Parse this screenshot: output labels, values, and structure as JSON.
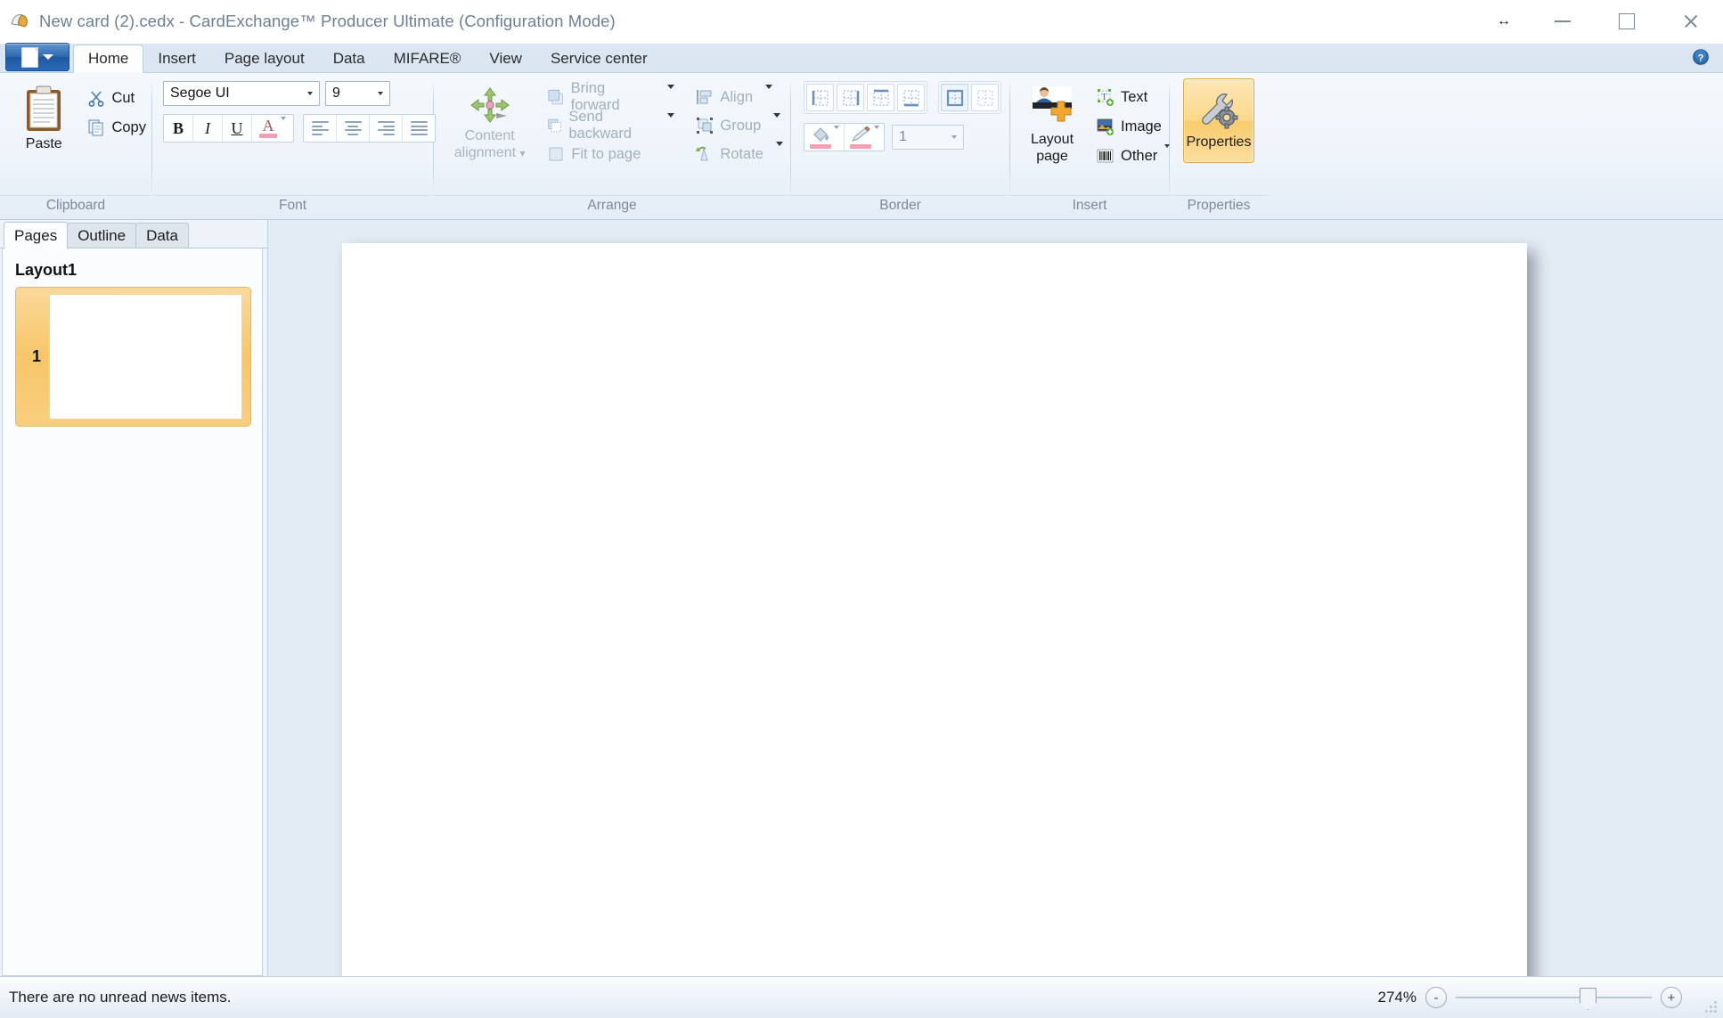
{
  "window": {
    "title": "New card (2).cedx - CardExchange™ Producer Ultimate (Configuration Mode)",
    "resize_glyph": "↔",
    "minimize_label": "Minimize",
    "maximize_label": "Maximize",
    "close_label": "Close"
  },
  "ribbon": {
    "tabs": [
      {
        "label": "Home",
        "active": true
      },
      {
        "label": "Insert",
        "active": false
      },
      {
        "label": "Page layout",
        "active": false
      },
      {
        "label": "Data",
        "active": false
      },
      {
        "label": "MIFARE®",
        "active": false
      },
      {
        "label": "View",
        "active": false
      },
      {
        "label": "Service center",
        "active": false
      }
    ],
    "groups": {
      "clipboard": {
        "label": "Clipboard",
        "paste": "Paste",
        "cut": "Cut",
        "copy": "Copy"
      },
      "font": {
        "label": "Font",
        "font_family": "Segoe UI",
        "font_size": "9",
        "bold": "B",
        "italic": "I",
        "underline": "U",
        "font_color": "A",
        "align_left": "Align left",
        "align_center": "Align center",
        "align_right": "Align right",
        "align_justify": "Justify"
      },
      "arrange": {
        "label": "Arrange",
        "content_alignment": "Content",
        "content_alignment2": "alignment",
        "bring_forward": "Bring forward",
        "send_backward": "Send backward",
        "fit_to_page": "Fit to page",
        "align": "Align",
        "group": "Group",
        "rotate": "Rotate"
      },
      "border": {
        "label": "Border",
        "border_left": "Left border",
        "border_right": "Right border",
        "border_top": "Top border",
        "border_bottom": "Bottom border",
        "border_all": "All borders",
        "border_none": "No border",
        "fill_color": "Fill color",
        "line_color": "Line color",
        "line_width": "1"
      },
      "insert": {
        "label": "Insert",
        "layout_page": "Layout",
        "layout_page2": "page",
        "text": "Text",
        "image": "Image",
        "other": "Other"
      },
      "properties": {
        "label": "Properties",
        "button": "Properties"
      }
    }
  },
  "sidebar": {
    "tabs": [
      {
        "label": "Pages",
        "active": true
      },
      {
        "label": "Outline",
        "active": false
      },
      {
        "label": "Data",
        "active": false
      }
    ],
    "layout_title": "Layout1",
    "page_thumbnail_number": "1"
  },
  "statusbar": {
    "message": "There are no unread news items.",
    "zoom_percent": "274%",
    "zoom_out": "-",
    "zoom_in": "+"
  },
  "colors": {
    "accent_orange": "#f6c559",
    "ribbon_blue": "#dce6f2",
    "canvas_bg": "#e3ebf5",
    "selection_yellow": "#fbd98c"
  }
}
